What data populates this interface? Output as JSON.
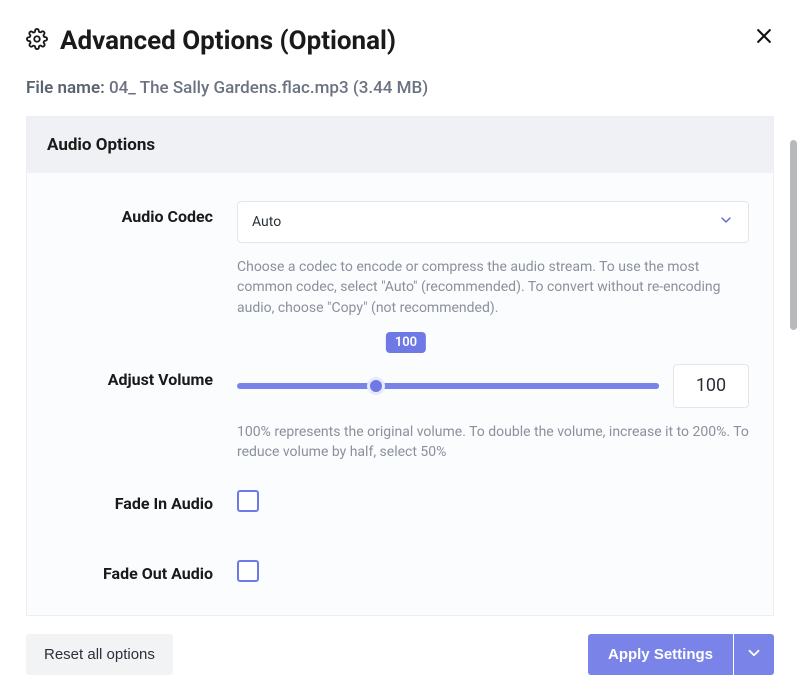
{
  "header": {
    "title": "Advanced Options (Optional)"
  },
  "file": {
    "label": "File name:",
    "name": "04_ The Sally Gardens.flac.mp3",
    "size": "(3.44 MB)"
  },
  "panel": {
    "heading": "Audio Options"
  },
  "codec": {
    "label": "Audio Codec",
    "value": "Auto",
    "help": "Choose a codec to encode or compress the audio stream. To use the most common codec, select \"Auto\" (recommended). To convert without re-encoding audio, choose \"Copy\" (not recommended)."
  },
  "volume": {
    "label": "Adjust Volume",
    "badge": "100",
    "input": "100",
    "help": "100% represents the original volume. To double the volume, increase it to 200%. To reduce volume by half, select 50%"
  },
  "fade_in": {
    "label": "Fade In Audio"
  },
  "fade_out": {
    "label": "Fade Out Audio"
  },
  "footer": {
    "reset": "Reset all options",
    "apply": "Apply Settings"
  }
}
